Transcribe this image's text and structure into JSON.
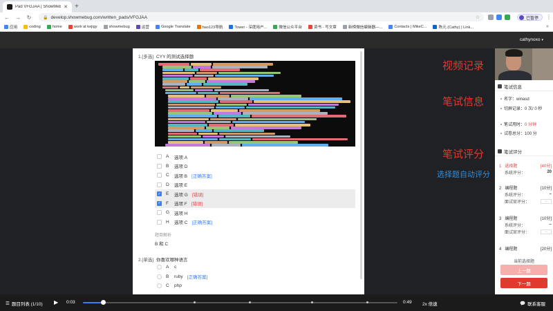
{
  "browser": {
    "tab_title": "Pad VFGJAA | ShowMeBug",
    "url": "develop.showmebug.com/written_pads/VFGJAA",
    "profile_label": "已暂停",
    "bookmarks": [
      "应用",
      "coding",
      "home",
      "work at kejigy",
      "showmebug",
      "运营",
      "Google Translate",
      "hao123导航",
      "Tower - 深度用户...",
      "微信公众平台",
      "资书 - 写文章",
      "新榜微信编辑器—...",
      "Contacts | MikeC...",
      "陈元 (Cathy) | Link..."
    ]
  },
  "header": {
    "username": "cathynoxo"
  },
  "q1": {
    "tag": "1.[多选]",
    "title": "CYY 的测试选择题",
    "options": [
      {
        "letter": "A",
        "text": "选项 A",
        "checked": false,
        "tag": "",
        "tag_type": ""
      },
      {
        "letter": "B",
        "text": "选项 D",
        "checked": false,
        "tag": "",
        "tag_type": ""
      },
      {
        "letter": "C",
        "text": "选项 B",
        "checked": false,
        "tag": "[正确答案]",
        "tag_type": "correct"
      },
      {
        "letter": "D",
        "text": "选项 E",
        "checked": false,
        "tag": "",
        "tag_type": ""
      },
      {
        "letter": "E",
        "text": "选项 G",
        "checked": true,
        "tag": "[错误]",
        "tag_type": "wrong"
      },
      {
        "letter": "F",
        "text": "选项 F",
        "checked": true,
        "tag": "[错误]",
        "tag_type": "wrong"
      },
      {
        "letter": "G",
        "text": "选项 H",
        "checked": false,
        "tag": "",
        "tag_type": ""
      },
      {
        "letter": "H",
        "text": "选项 C",
        "checked": false,
        "tag": "[正确答案]",
        "tag_type": "correct"
      }
    ],
    "analysis_label": "题目解析",
    "analysis": "B 和 C"
  },
  "q2": {
    "tag": "2.[单选]",
    "title": "你喜欢哪种语言",
    "options": [
      {
        "letter": "A",
        "text": "c",
        "tag": "",
        "tag_type": ""
      },
      {
        "letter": "B",
        "text": "ruby",
        "tag": "[正确答案]",
        "tag_type": "correct"
      },
      {
        "letter": "C",
        "text": "php",
        "tag": "",
        "tag_type": ""
      }
    ]
  },
  "annotations": {
    "video": "视频记录",
    "info": "笔试信息",
    "score": "笔试评分",
    "auto": "选择题自动评分"
  },
  "info_panel": {
    "title": "笔试信息",
    "name_label": "名字：",
    "name_value": "winasd",
    "switch_label": "切屏记录：",
    "switch_value": "0 次/ 0 秒",
    "used_label": "笔试用时：",
    "used_value": "0 分钟",
    "total_label": "试卷总分：",
    "total_value": "100 分"
  },
  "score_panel": {
    "title": "笔试评分",
    "items": [
      {
        "num": "1",
        "type": "选择题",
        "points": "[40分]",
        "sys_label": "系统评分：",
        "sys_value": "20",
        "manual_label": ""
      },
      {
        "num": "2",
        "type": "编程题",
        "points": "[10分]",
        "sys_label": "系统评分：",
        "sys_value": "–",
        "manual_label": "面试官评分：",
        "manual_value": "–"
      },
      {
        "num": "3",
        "type": "编程题",
        "points": "[10分]",
        "sys_label": "系统评分：",
        "sys_value": "–",
        "manual_label": "面试官评分：",
        "manual_value": "–"
      },
      {
        "num": "4",
        "type": "编程题",
        "points": "[20分]"
      }
    ],
    "current_label": "当前选择题",
    "prev": "上一题",
    "next": "下一题"
  },
  "player": {
    "list_label": "题目列表 (1/10)",
    "current_time": "0:03",
    "total_time": "0:49",
    "speed": "2x 倍速",
    "support": "联系客服",
    "progress": 0.065
  },
  "colors": {
    "accent": "#3d7ff0",
    "red": "#e03a2f",
    "blue": "#2f8fe0"
  }
}
